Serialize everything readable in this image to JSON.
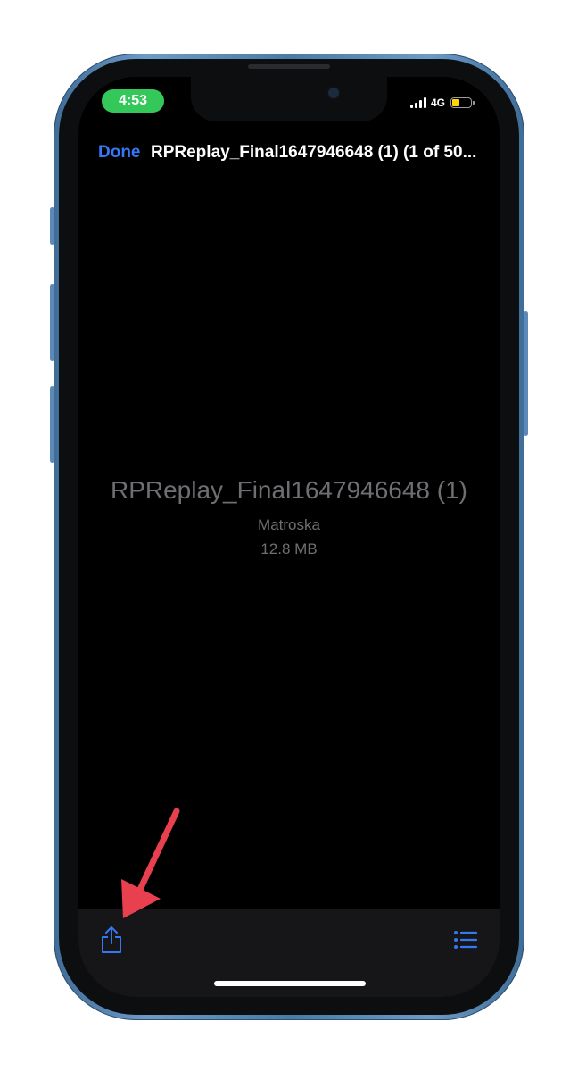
{
  "status_bar": {
    "time": "4:53",
    "network": "4G",
    "battery_level": 0.4,
    "colors": {
      "time_pill": "#34c759",
      "battery": "#ffd60a"
    }
  },
  "nav": {
    "done_label": "Done",
    "title": "RPReplay_Final1647946648 (1) (1 of 50..."
  },
  "file": {
    "name": "RPReplay_Final1647946648 (1)",
    "type": "Matroska",
    "size": "12.8 MB"
  },
  "toolbar": {
    "share_icon": "share-icon",
    "list_icon": "list-icon"
  },
  "colors": {
    "accent": "#3478f6",
    "annotation_arrow": "#e8404f",
    "phone_frame": "#4b7aa6"
  }
}
